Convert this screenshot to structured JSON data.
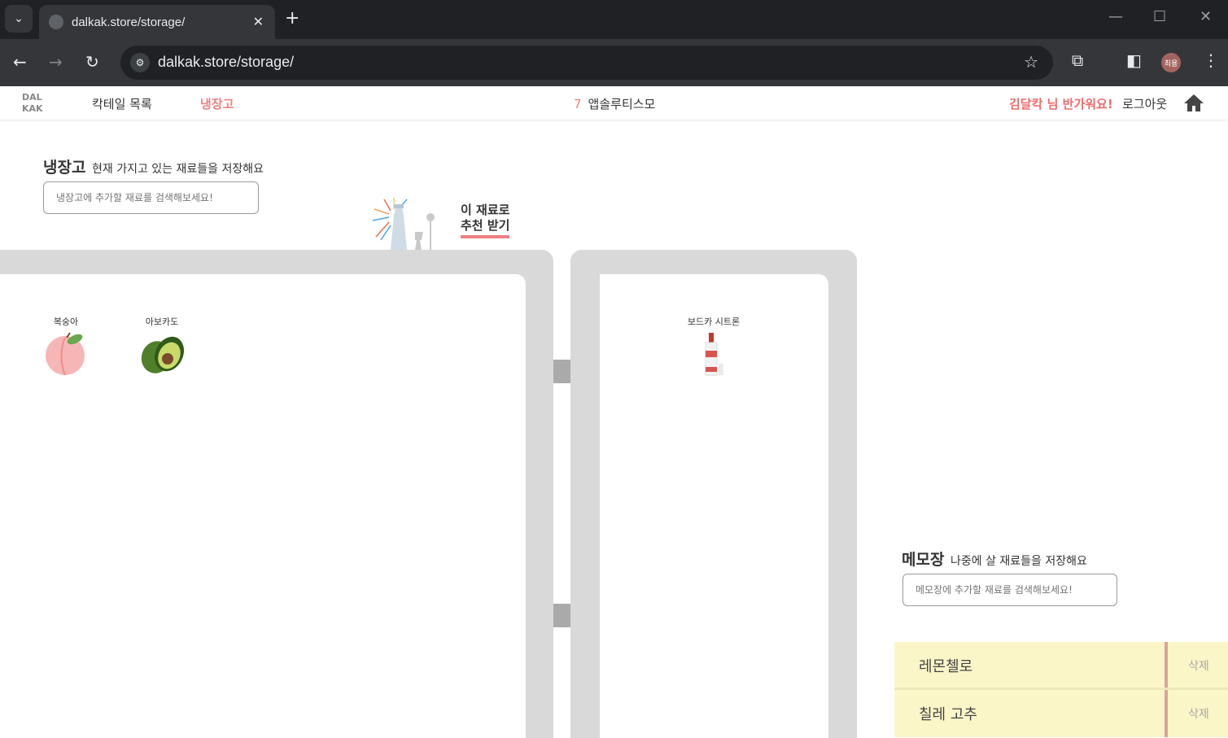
{
  "browser": {
    "tab_title": "dalkak.store/storage/",
    "url": "dalkak.store/storage/",
    "profile_label": "최용"
  },
  "header": {
    "logo_line1": "DAL",
    "logo_line2": "KAK",
    "nav_cocktails": "칵테일 목록",
    "nav_fridge": "냉장고",
    "ticker_rank": "7",
    "ticker_text": "앱솔루티스모",
    "greeting": "김달칵 님 반가워요!",
    "logout": "로그아웃"
  },
  "fridge": {
    "title": "냉장고",
    "description": "현재 가지고 있는 재료들을 저장해요",
    "search_placeholder": "냉장고에 추가할 재료를 검색해보세요!",
    "recommend_line1": "이 재료로",
    "recommend_line2": "추천 받기",
    "left_items": [
      {
        "label": "복숭아",
        "icon": "peach-icon"
      },
      {
        "label": "아보카도",
        "icon": "avocado-icon"
      }
    ],
    "right_items": [
      {
        "label": "보드카 시트론",
        "icon": "bottle-icon"
      }
    ]
  },
  "memo": {
    "title": "메모장",
    "description": "나중에 살 재료들을 저장해요",
    "search_placeholder": "메모장에 추가할 재료를 검색해보세요!",
    "items": [
      {
        "name": "레몬첼로",
        "delete": "삭제"
      },
      {
        "name": "칠레 고추",
        "delete": "삭제"
      }
    ]
  },
  "colors": {
    "accent": "#f08080",
    "frame": "#d9d9d9",
    "memo_bg": "#fbf6c8"
  }
}
